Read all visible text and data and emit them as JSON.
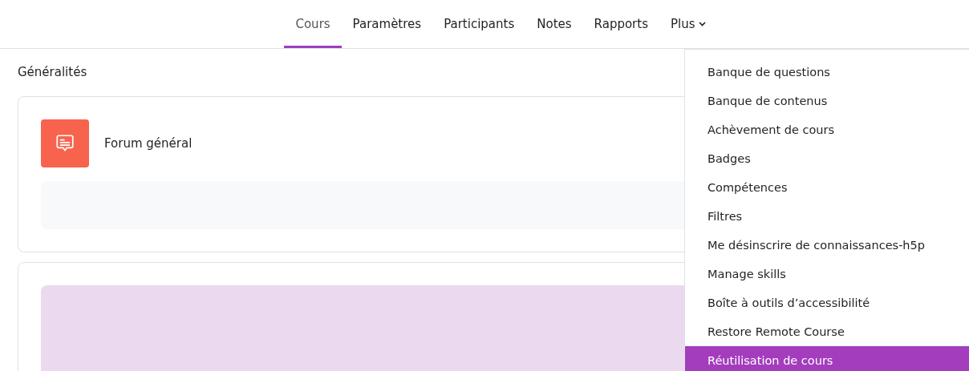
{
  "tabs": [
    {
      "label": "Cours",
      "selected": true
    },
    {
      "label": "Paramètres",
      "selected": false
    },
    {
      "label": "Participants",
      "selected": false
    },
    {
      "label": "Notes",
      "selected": false
    },
    {
      "label": "Rapports",
      "selected": false
    },
    {
      "label": "Plus",
      "selected": false,
      "kind": "dropdown"
    }
  ],
  "section": {
    "title": "Généralités"
  },
  "activities": [
    {
      "kind": "forum",
      "name": "Forum général"
    }
  ],
  "menu": {
    "items": [
      {
        "label": "Banque de questions",
        "selected": false
      },
      {
        "label": "Banque de contenus",
        "selected": false
      },
      {
        "label": "Achèvement de cours",
        "selected": false
      },
      {
        "label": "Badges",
        "selected": false
      },
      {
        "label": "Compétences",
        "selected": false
      },
      {
        "label": "Filtres",
        "selected": false
      },
      {
        "label": "Me désinscrire de connaissances-h5p",
        "selected": false
      },
      {
        "label": "Manage skills",
        "selected": false
      },
      {
        "label": "Boîte à outils d’accessibilité",
        "selected": false
      },
      {
        "label": "Restore Remote Course",
        "selected": false
      },
      {
        "label": "Réutilisation de cours",
        "selected": true
      }
    ]
  }
}
